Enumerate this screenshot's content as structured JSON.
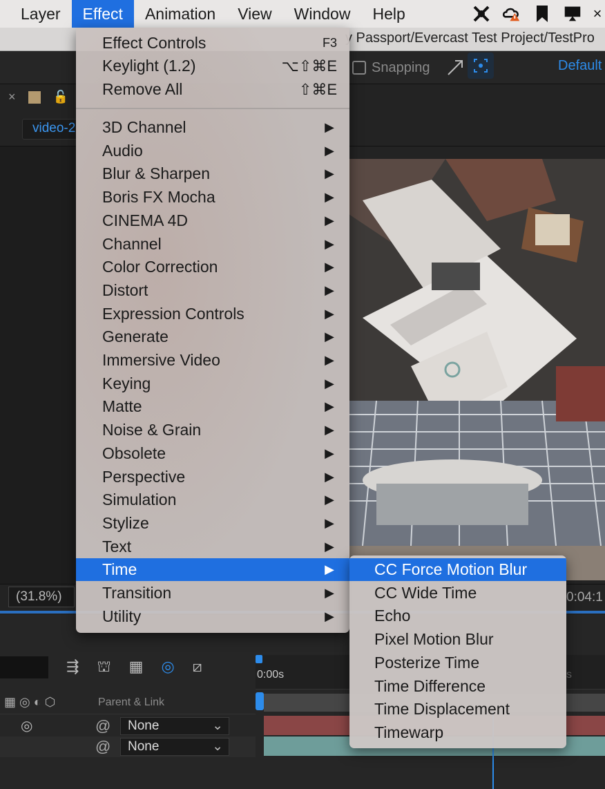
{
  "menubar": {
    "items": [
      {
        "label": "Layer"
      },
      {
        "label": "Effect",
        "active": true
      },
      {
        "label": "Animation"
      },
      {
        "label": "View"
      },
      {
        "label": "Window"
      },
      {
        "label": "Help"
      }
    ]
  },
  "titlebar": {
    "text": "y Passport/Evercast Test Project/TestPro"
  },
  "toolbar": {
    "snapping_label": "Snapping",
    "workspace_label": "Default"
  },
  "composition": {
    "tab_label": "video-2"
  },
  "viewer": {
    "zoom_value": "(31.8%)",
    "timecode": "0:04:1"
  },
  "timeline": {
    "parent_link_label": "Parent & Link",
    "ruler_start": "0:00s",
    "ruler_end": "s",
    "rows": [
      {
        "parent": "None"
      },
      {
        "parent": "None"
      }
    ]
  },
  "effect_menu": {
    "top_items": [
      {
        "label": "Effect Controls",
        "shortcut": "F3"
      },
      {
        "label": "Keylight (1.2)",
        "shortcut": "⌥⇧⌘E"
      },
      {
        "label": "Remove All",
        "shortcut": "⇧⌘E"
      }
    ],
    "categories": [
      {
        "label": "3D Channel"
      },
      {
        "label": "Audio"
      },
      {
        "label": "Blur & Sharpen"
      },
      {
        "label": "Boris FX Mocha"
      },
      {
        "label": "CINEMA 4D"
      },
      {
        "label": "Channel"
      },
      {
        "label": "Color Correction"
      },
      {
        "label": "Distort"
      },
      {
        "label": "Expression Controls"
      },
      {
        "label": "Generate"
      },
      {
        "label": "Immersive Video"
      },
      {
        "label": "Keying"
      },
      {
        "label": "Matte"
      },
      {
        "label": "Noise & Grain"
      },
      {
        "label": "Obsolete"
      },
      {
        "label": "Perspective"
      },
      {
        "label": "Simulation"
      },
      {
        "label": "Stylize"
      },
      {
        "label": "Text"
      },
      {
        "label": "Time",
        "active": true
      },
      {
        "label": "Transition"
      },
      {
        "label": "Utility"
      }
    ],
    "submenu_arrow": "▶"
  },
  "time_submenu": {
    "items": [
      {
        "label": "CC Force Motion Blur",
        "active": true
      },
      {
        "label": "CC Wide Time"
      },
      {
        "label": "Echo"
      },
      {
        "label": "Pixel Motion Blur"
      },
      {
        "label": "Posterize Time"
      },
      {
        "label": "Time Difference"
      },
      {
        "label": "Time Displacement"
      },
      {
        "label": "Timewarp"
      }
    ]
  },
  "colors": {
    "accent": "#1f6fe0",
    "ae_blue": "#2d8ceb",
    "menu_bg": "#cac3c1"
  }
}
